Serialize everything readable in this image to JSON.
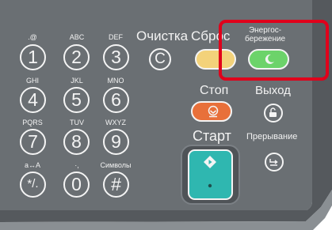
{
  "keypad": {
    "keys": [
      {
        "digit": "1",
        "letters": ".@"
      },
      {
        "digit": "2",
        "letters": "ABC"
      },
      {
        "digit": "3",
        "letters": "DEF"
      },
      {
        "digit": "4",
        "letters": "GHI"
      },
      {
        "digit": "5",
        "letters": "JKL"
      },
      {
        "digit": "6",
        "letters": "MNO"
      },
      {
        "digit": "7",
        "letters": "PQRS"
      },
      {
        "digit": "8",
        "letters": "TUV"
      },
      {
        "digit": "9",
        "letters": "WXYZ"
      },
      {
        "digit": "*/.",
        "letters": "a↔A"
      },
      {
        "digit": "0",
        "letters": "·,"
      },
      {
        "digit": "#",
        "letters": "Символы"
      }
    ]
  },
  "clear": {
    "label": "Очистка",
    "key": "C"
  },
  "reset": {
    "label": "Сброс",
    "color": "#f3d27a"
  },
  "energy_saver": {
    "label_line1": "Энергос-",
    "label_line2": "бережение",
    "icon": "moon-icon",
    "color": "#6cd36a"
  },
  "stop": {
    "label": "Стоп",
    "icon": "stop-icon",
    "color": "#e8703a"
  },
  "logout": {
    "label": "Выход",
    "icon": "logout-lock-icon"
  },
  "start": {
    "label": "Старт",
    "icon": "start-diamond-icon",
    "color": "#2fb7b0"
  },
  "interrupt": {
    "label": "Прерывание",
    "icon": "interrupt-icon"
  },
  "highlight_color": "#e0001b"
}
